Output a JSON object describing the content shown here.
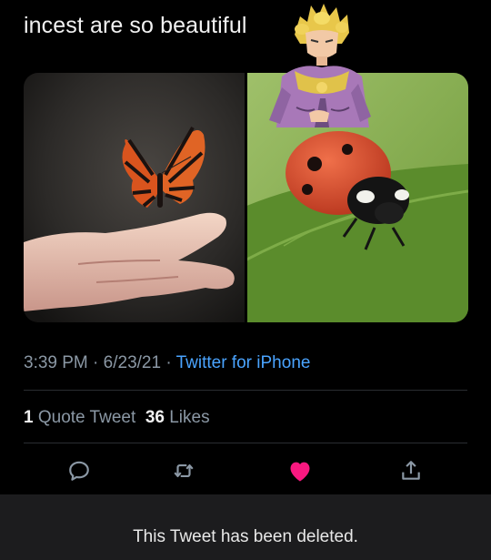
{
  "tweet": {
    "text": "incest are so beautiful"
  },
  "meta": {
    "time": "3:39 PM",
    "separator1": " · ",
    "date": "6/23/21",
    "separator2": " · ",
    "via": "Twitter for iPhone"
  },
  "stats": {
    "quote_count": "1",
    "quote_label": "Quote Tweet",
    "like_count": "36",
    "like_label": "Likes"
  },
  "actions": {
    "reply_icon": "reply-bubble-icon",
    "retweet_icon": "retweet-icon",
    "like_icon": "heart-filled-icon",
    "share_icon": "share-upload-icon",
    "like_color": "#f91880",
    "icon_color": "#8b98a5"
  },
  "deleted_notice": {
    "text": "This Tweet has been deleted."
  }
}
